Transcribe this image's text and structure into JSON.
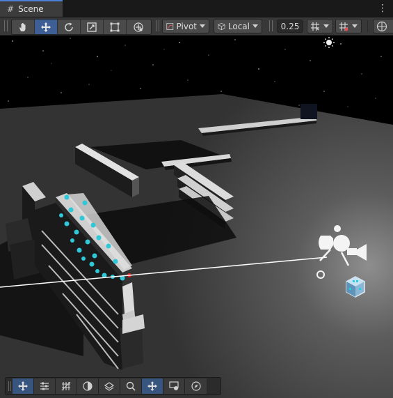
{
  "tab": {
    "title": "Scene",
    "icon": "hash-icon",
    "menu_icon": "kebab-menu-icon"
  },
  "toolbar": {
    "tools": [
      {
        "name": "view-tool",
        "icon": "hand-icon",
        "active": false
      },
      {
        "name": "move-tool",
        "icon": "move-arrows-icon",
        "active": true
      },
      {
        "name": "rotate-tool",
        "icon": "rotate-icon",
        "active": false
      },
      {
        "name": "scale-tool",
        "icon": "scale-icon",
        "active": false
      },
      {
        "name": "rect-tool",
        "icon": "rect-transform-icon",
        "active": false
      },
      {
        "name": "transform-tool",
        "icon": "transform-icon",
        "active": false
      }
    ],
    "pivot_label": "Pivot",
    "local_label": "Local",
    "snap_value": "0.25"
  },
  "overlay_toolbar": {
    "items": [
      {
        "name": "transform-overlay",
        "icon": "move-arrows-icon",
        "active": true
      },
      {
        "name": "tool-settings",
        "icon": "sliders-icon",
        "active": false
      },
      {
        "name": "grid-overlay",
        "icon": "grid-icon",
        "active": false
      },
      {
        "name": "orientation-overlay",
        "icon": "half-circle-icon",
        "active": false
      },
      {
        "name": "visibility-overlay",
        "icon": "layers-icon",
        "active": false
      },
      {
        "name": "search-overlay",
        "icon": "search-icon",
        "active": false
      },
      {
        "name": "move-overlay",
        "icon": "move-arrows-icon",
        "active": true
      },
      {
        "name": "view-options",
        "icon": "eye-monitor-icon",
        "active": false
      },
      {
        "name": "navigation-overlay",
        "icon": "compass-icon",
        "active": false
      }
    ]
  },
  "colors": {
    "accent": "#3e5f96",
    "gizmo_cyan": "#2ec8d8",
    "sky": "#000000",
    "ground": "#3a3a3a"
  }
}
